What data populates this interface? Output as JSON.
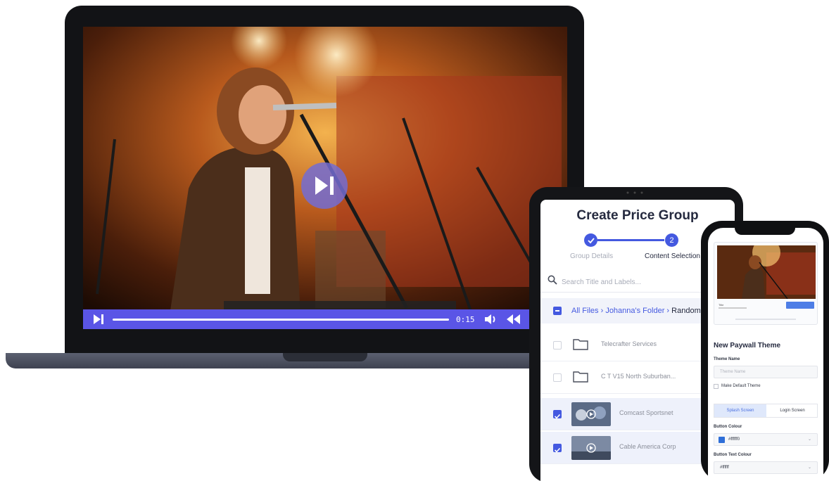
{
  "laptop": {
    "player": {
      "current_time": "0:15",
      "accent_color": "#5a55e6"
    }
  },
  "tablet": {
    "title": "Create Price Group",
    "steps": [
      {
        "number": "1",
        "label": "Group Details",
        "state": "completed"
      },
      {
        "number": "2",
        "label": "Content Selection",
        "state": "active"
      }
    ],
    "search_placeholder": "Search Title and Labels...",
    "breadcrumb": {
      "root": "All Files",
      "folder": "Johanna's Folder",
      "current": "Random"
    },
    "files": [
      {
        "type": "folder",
        "name": "Telecrafter Services",
        "selected": false
      },
      {
        "type": "folder",
        "name": "C T V15 North Suburban...",
        "selected": false
      },
      {
        "type": "video",
        "name": "Comcast Sportsnet",
        "selected": true
      },
      {
        "type": "video",
        "name": "Cable America Corp",
        "selected": true
      }
    ],
    "accent_color": "#4459e0"
  },
  "phone": {
    "preview": {
      "title": "Title",
      "button_color": "#4e7ee6"
    },
    "heading": "New Paywall Theme",
    "theme_name_label": "Theme Name",
    "theme_name_placeholder": "Theme Name",
    "default_theme_label": "Make Default Theme",
    "tabs": [
      "Splash Screen",
      "Login Screen"
    ],
    "active_tab": "Splash Screen",
    "button_colour_label": "Button Colour",
    "button_colour_value": "#ffffff0",
    "button_colour_swatch": "#2f6fd8",
    "button_text_colour_label": "Button Text Colour",
    "button_text_colour_value": "#ffffff"
  }
}
